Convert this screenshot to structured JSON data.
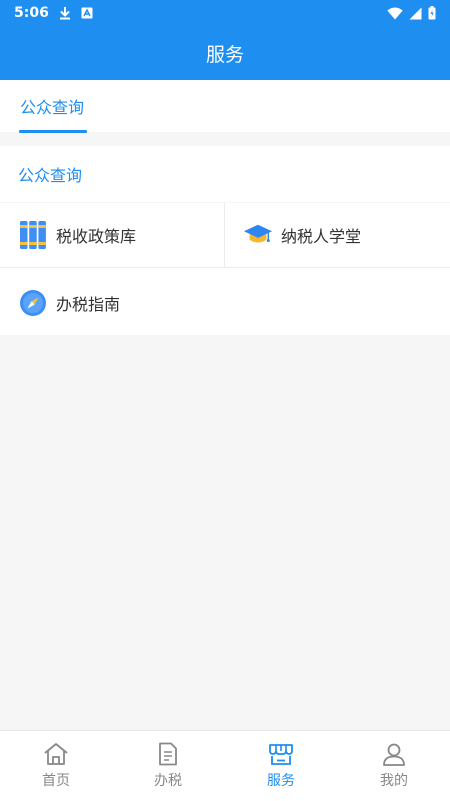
{
  "status": {
    "time": "5:06"
  },
  "header": {
    "title": "服务"
  },
  "tabs": [
    {
      "label": "公众查询"
    }
  ],
  "section": {
    "title": "公众查询"
  },
  "items": [
    {
      "label": "税收政策库",
      "icon": "books-icon"
    },
    {
      "label": "纳税人学堂",
      "icon": "graduation-cap-icon"
    },
    {
      "label": "办税指南",
      "icon": "compass-icon"
    }
  ],
  "bottom_nav": [
    {
      "label": "首页",
      "icon": "home-icon"
    },
    {
      "label": "办税",
      "icon": "document-icon"
    },
    {
      "label": "服务",
      "icon": "store-icon",
      "active": true
    },
    {
      "label": "我的",
      "icon": "user-icon"
    }
  ],
  "colors": {
    "primary": "#1e8ef0",
    "background": "#f6f6f6",
    "text": "#333333",
    "inactive": "#888888"
  }
}
